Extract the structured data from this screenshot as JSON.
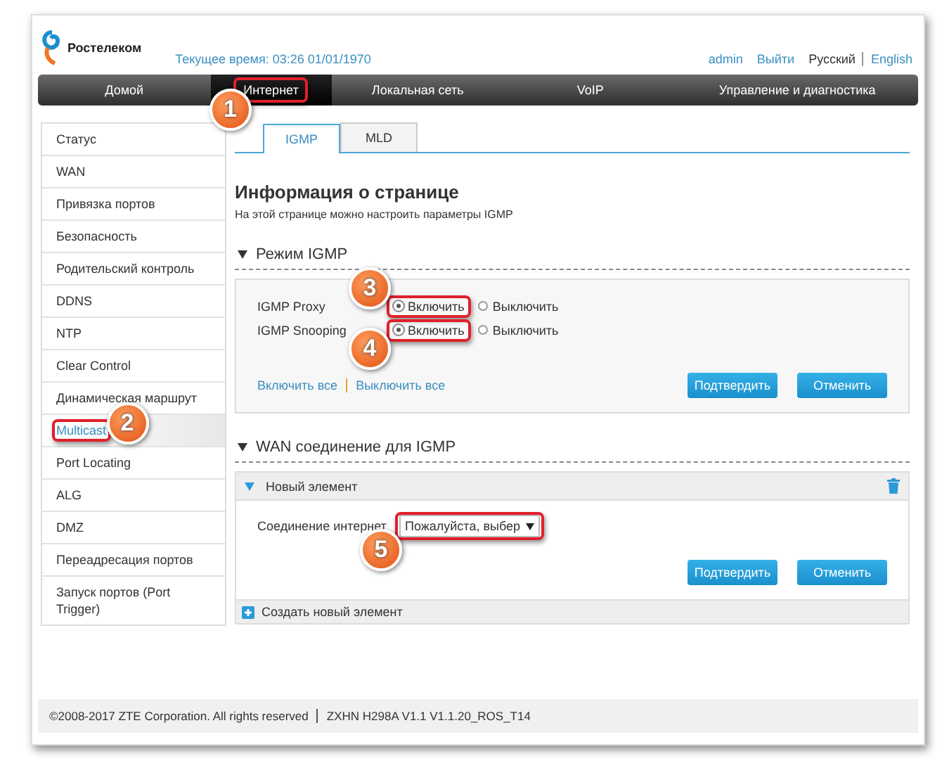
{
  "header": {
    "logo": "Ростелеком",
    "time_label": "Текущее время: 03:26 01/01/1970",
    "user": "admin",
    "logout": "Выйти",
    "languages": [
      {
        "label": "Русский",
        "selected": true
      },
      {
        "label": "English",
        "selected": false
      }
    ]
  },
  "nav": [
    {
      "label": "Домой",
      "selected": false
    },
    {
      "label": "Интернет",
      "selected": true,
      "callout": "1"
    },
    {
      "label": "Локальная сеть",
      "selected": false
    },
    {
      "label": "VoIP",
      "selected": false
    },
    {
      "label": "Управление и диагностика",
      "selected": false
    }
  ],
  "sidebar": [
    {
      "label": "Статус",
      "selected": false
    },
    {
      "label": "WAN",
      "selected": false
    },
    {
      "label": "Привязка портов",
      "selected": false
    },
    {
      "label": "Безопасность",
      "selected": false
    },
    {
      "label": "Родительский контроль",
      "selected": false
    },
    {
      "label": "DDNS",
      "selected": false
    },
    {
      "label": "NTP",
      "selected": false
    },
    {
      "label": "Clear Control",
      "selected": false
    },
    {
      "label": "Динамическая маршрут",
      "selected": false
    },
    {
      "label": "Multicast",
      "selected": true,
      "callout": "2"
    },
    {
      "label": "Port Locating",
      "selected": false
    },
    {
      "label": "ALG",
      "selected": false
    },
    {
      "label": "DMZ",
      "selected": false
    },
    {
      "label": "Переадресация портов",
      "selected": false
    },
    {
      "label": "Запуск портов (Port Trigger)",
      "selected": false
    }
  ],
  "tabs": [
    {
      "label": "IGMP",
      "selected": true
    },
    {
      "label": "MLD",
      "selected": false
    }
  ],
  "page_title": "Информация о странице",
  "page_description": "На этой странице можно настроить параметры IGMP",
  "igmp_mode": {
    "title": "Режим IGMP",
    "expanded": true,
    "rows": [
      {
        "label": "IGMP Proxy",
        "options": [
          {
            "label": "Включить",
            "selected": true,
            "callout": "3"
          },
          {
            "label": "Выключить",
            "selected": false
          }
        ]
      },
      {
        "label": "IGMP Snooping",
        "options": [
          {
            "label": "Включить",
            "selected": true,
            "callout": "4"
          },
          {
            "label": "Выключить",
            "selected": false
          }
        ]
      }
    ],
    "links": [
      "Включить все",
      "Выключить все"
    ],
    "buttons": [
      "Подтвердить",
      "Отменить"
    ]
  },
  "wan": {
    "title": "WAN соединение для IGMP",
    "expanded": true,
    "item": {
      "title": "Новый элемент",
      "expanded": true,
      "field_label": "Соединение интернет",
      "select_value": "Пожалуйста, выбер",
      "callout": "5",
      "buttons": [
        "Подтвердить",
        "Отменить"
      ]
    },
    "add_label": "Создать новый элемент"
  },
  "footer": {
    "copyright": "©2008-2017 ZTE Corporation. All rights reserved",
    "version": "ZXHN H298A V1.1 V1.1.20_ROS_T14"
  }
}
